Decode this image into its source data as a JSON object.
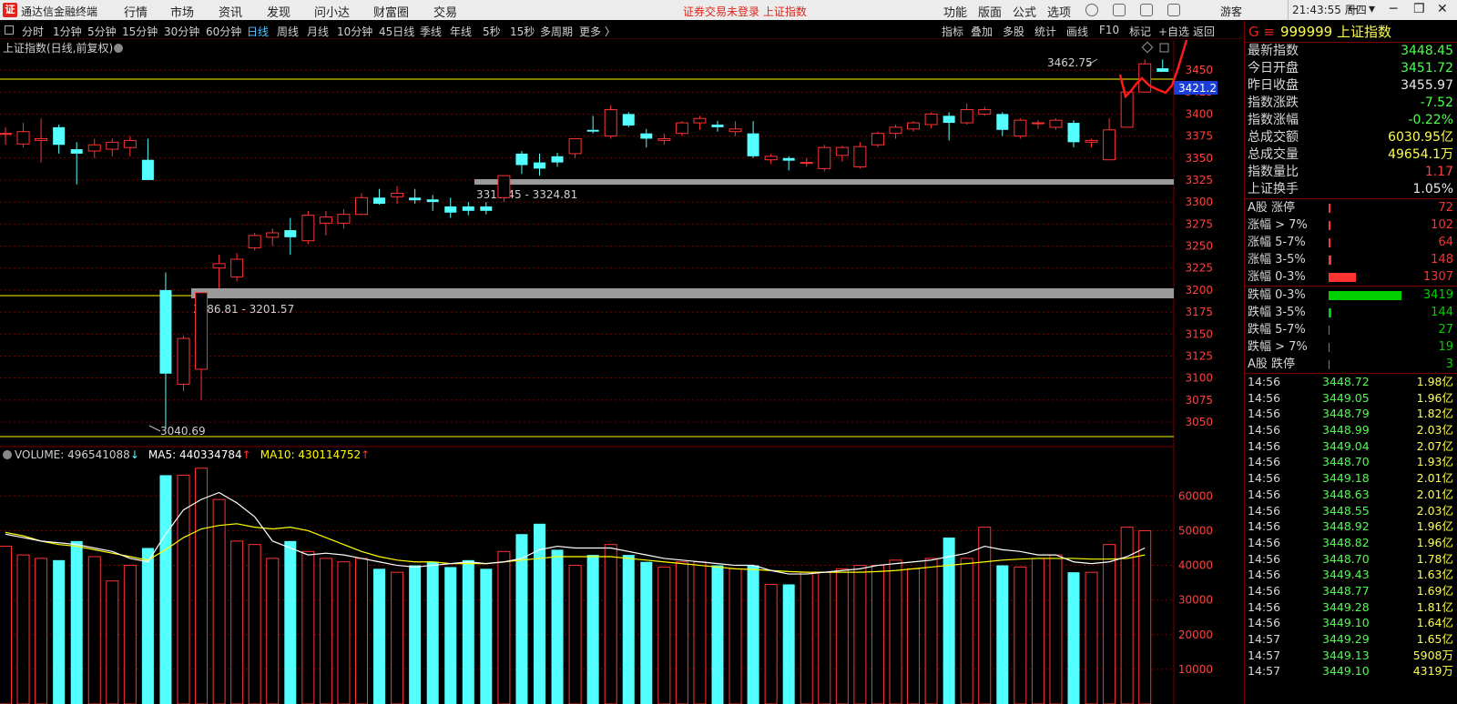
{
  "app": {
    "name": "通达信金融终端",
    "logo": "证",
    "menus": [
      "行情",
      "市场",
      "资讯",
      "发现",
      "问小达",
      "财富圈",
      "交易"
    ],
    "notice": "证券交易未登录  上证指数",
    "right_menus": [
      "功能",
      "版面",
      "公式",
      "选项"
    ],
    "guest": "游客",
    "time": "21:43:55 周四",
    "win_controls": [
      "←",
      "▾",
      "─",
      "❐",
      "✕"
    ]
  },
  "periods": {
    "items": [
      "分时",
      "1分钟",
      "5分钟",
      "15分钟",
      "30分钟",
      "60分钟",
      "日线",
      "周线",
      "月线",
      "10分钟",
      "45日线",
      "季线",
      "年线",
      "5秒",
      "15秒",
      "多周期",
      "更多 〉"
    ],
    "active": "日线",
    "right": [
      "指标",
      "叠加",
      "多股",
      "统计",
      "画线",
      "F10",
      "标记",
      "+自选",
      "返回"
    ]
  },
  "main": {
    "title": "上证指数(日线,前复权)",
    "current_price_tag": "3421.2",
    "high_label": "3462.75",
    "low_label": "3040.69",
    "band1_label": "3316.45 - 3324.81",
    "band2_label": "3186.81 - 3201.57"
  },
  "volume_header": {
    "volume_label": "VOLUME: 496541088",
    "ma5_label": "MA5: 440334784",
    "ma10_label": "MA10: 430114752",
    "down_arrow": "↓",
    "up_arrow": "↑"
  },
  "colors": {
    "up": "#ff3232",
    "down": "#54ffff",
    "grid": "#7a0000",
    "ma5": "#ffffff",
    "ma10": "#ffff00",
    "green": "#00c800"
  },
  "chart_data": {
    "type": "candlestick",
    "y_ticks": [
      "3450",
      "3425",
      "3400",
      "3375",
      "3350",
      "3325",
      "3300",
      "3275",
      "3250",
      "3225",
      "3200",
      "3175",
      "3150",
      "3125",
      "3100",
      "3075",
      "3050"
    ],
    "y_range": [
      3038,
      3472
    ],
    "ohlc": [
      [
        3378,
        3385,
        3365,
        3378
      ],
      [
        3366,
        3390,
        3362,
        3380
      ],
      [
        3370,
        3395,
        3345,
        3372
      ],
      [
        3385,
        3388,
        3355,
        3365
      ],
      [
        3360,
        3368,
        3320,
        3355
      ],
      [
        3358,
        3372,
        3350,
        3365
      ],
      [
        3360,
        3372,
        3352,
        3368
      ],
      [
        3362,
        3375,
        3352,
        3370
      ],
      [
        3348,
        3372,
        3345,
        3325
      ],
      [
        3200,
        3220,
        3042,
        3105
      ],
      [
        3093,
        3148,
        3085,
        3145
      ],
      [
        3110,
        3195,
        3075,
        3197
      ],
      [
        3225,
        3240,
        3202,
        3230
      ],
      [
        3215,
        3242,
        3210,
        3235
      ],
      [
        3248,
        3265,
        3245,
        3262
      ],
      [
        3260,
        3270,
        3250,
        3265
      ],
      [
        3268,
        3282,
        3240,
        3260
      ],
      [
        3256,
        3290,
        3252,
        3285
      ],
      [
        3276,
        3290,
        3262,
        3283
      ],
      [
        3276,
        3292,
        3270,
        3286
      ],
      [
        3286,
        3310,
        3285,
        3305
      ],
      [
        3305,
        3315,
        3297,
        3298
      ],
      [
        3306,
        3318,
        3298,
        3310
      ],
      [
        3305,
        3315,
        3298,
        3302
      ],
      [
        3303,
        3308,
        3290,
        3300
      ],
      [
        3295,
        3305,
        3282,
        3288
      ],
      [
        3295,
        3300,
        3285,
        3290
      ],
      [
        3295,
        3300,
        3286,
        3290
      ],
      [
        3305,
        3325,
        3300,
        3330
      ],
      [
        3355,
        3358,
        3332,
        3342
      ],
      [
        3345,
        3355,
        3330,
        3338
      ],
      [
        3352,
        3356,
        3340,
        3345
      ],
      [
        3355,
        3372,
        3350,
        3372
      ],
      [
        3382,
        3398,
        3378,
        3380
      ],
      [
        3375,
        3410,
        3372,
        3405
      ],
      [
        3400,
        3402,
        3385,
        3387
      ],
      [
        3378,
        3383,
        3362,
        3372
      ],
      [
        3370,
        3378,
        3365,
        3372
      ],
      [
        3378,
        3392,
        3375,
        3390
      ],
      [
        3390,
        3398,
        3382,
        3395
      ],
      [
        3388,
        3392,
        3380,
        3385
      ],
      [
        3380,
        3392,
        3375,
        3383
      ],
      [
        3378,
        3392,
        3350,
        3352
      ],
      [
        3348,
        3355,
        3343,
        3352
      ],
      [
        3350,
        3352,
        3336,
        3347
      ],
      [
        3345,
        3350,
        3340,
        3345
      ],
      [
        3338,
        3365,
        3335,
        3362
      ],
      [
        3353,
        3364,
        3346,
        3362
      ],
      [
        3340,
        3368,
        3338,
        3363
      ],
      [
        3365,
        3380,
        3362,
        3378
      ],
      [
        3378,
        3388,
        3372,
        3385
      ],
      [
        3383,
        3392,
        3380,
        3390
      ],
      [
        3388,
        3402,
        3384,
        3400
      ],
      [
        3398,
        3402,
        3370,
        3390
      ],
      [
        3390,
        3412,
        3388,
        3405
      ],
      [
        3400,
        3408,
        3398,
        3405
      ],
      [
        3400,
        3402,
        3375,
        3382
      ],
      [
        3375,
        3395,
        3372,
        3393
      ],
      [
        3390,
        3393,
        3383,
        3390
      ],
      [
        3385,
        3395,
        3382,
        3393
      ],
      [
        3390,
        3393,
        3362,
        3368
      ],
      [
        3368,
        3372,
        3362,
        3370
      ],
      [
        3348,
        3395,
        3348,
        3382
      ],
      [
        3385,
        3422,
        3385,
        3425
      ],
      [
        3425,
        3462,
        3425,
        3457
      ],
      [
        3452,
        3462,
        3448,
        3448
      ]
    ],
    "volume_ticks": [
      "60000",
      "50000",
      "40000",
      "30000",
      "20000",
      "10000"
    ],
    "volume_range": [
      0,
      69000
    ],
    "volume": [
      45500,
      43000,
      42000,
      41500,
      47000,
      42500,
      35500,
      40000,
      45000,
      66000,
      66000,
      68000,
      59000,
      47000,
      46000,
      42000,
      47000,
      44000,
      42000,
      41000,
      42000,
      39000,
      38000,
      40000,
      41000,
      39500,
      41500,
      39000,
      44000,
      49000,
      52000,
      44500,
      40000,
      43000,
      46000,
      43000,
      41000,
      39500,
      41000,
      41000,
      40000,
      39000,
      40000,
      34500,
      34500,
      38000,
      38000,
      39000,
      40000,
      40000,
      41500,
      39000,
      42000,
      48000,
      42000,
      51000,
      40000,
      39500,
      42000,
      43000,
      38000,
      38000,
      46000,
      51000,
      50000
    ],
    "ma5": [
      49000,
      48000,
      47000,
      46500,
      46000,
      45000,
      44000,
      42000,
      41000,
      49000,
      56000,
      59000,
      61000,
      58000,
      54000,
      47000,
      45000,
      43000,
      43500,
      43000,
      42000,
      41000,
      40000,
      39500,
      40000,
      40500,
      41000,
      40500,
      41000,
      42000,
      44500,
      45500,
      45000,
      45000,
      45000,
      44000,
      43000,
      42000,
      41500,
      41000,
      40500,
      40000,
      40000,
      38500,
      37500,
      37500,
      38000,
      38500,
      39000,
      40000,
      40500,
      41000,
      41500,
      42500,
      43500,
      45500,
      44500,
      44000,
      43000,
      43000,
      41000,
      40500,
      41000,
      42500,
      45000
    ],
    "ma10": [
      49500,
      48500,
      47000,
      46000,
      45500,
      44500,
      43500,
      42500,
      41500,
      44500,
      48000,
      50500,
      51500,
      52000,
      51000,
      50500,
      51000,
      50000,
      48000,
      46000,
      44000,
      42500,
      41500,
      41000,
      41000,
      40500,
      40500,
      40500,
      41000,
      41500,
      42000,
      42500,
      42500,
      42500,
      42500,
      42000,
      41500,
      41000,
      40500,
      40000,
      39500,
      39000,
      38800,
      38500,
      38200,
      38000,
      38000,
      38000,
      38000,
      38200,
      38500,
      39000,
      39500,
      40000,
      40500,
      41000,
      41500,
      41800,
      42000,
      42000,
      42000,
      41800,
      41800,
      42000,
      43000
    ]
  },
  "info": {
    "code": "999999",
    "name": "上证指数",
    "g": "G ≡",
    "quotes": [
      {
        "k": "最新指数",
        "v": "3448.45",
        "c": "#4cff4c"
      },
      {
        "k": "今日开盘",
        "v": "3451.72",
        "c": "#4cff4c"
      },
      {
        "k": "昨日收盘",
        "v": "3455.97",
        "c": "#e8e8e8"
      },
      {
        "k": "指数涨跌",
        "v": "-7.52",
        "c": "#4cff4c"
      },
      {
        "k": "指数涨幅",
        "v": "-0.22%",
        "c": "#4cff4c"
      },
      {
        "k": "总成交额",
        "v": "6030.95亿",
        "c": "#ffff4a"
      },
      {
        "k": "总成交量",
        "v": "49654.1万",
        "c": "#ffff4a"
      },
      {
        "k": "指数量比",
        "v": "1.17",
        "c": "#ff4040"
      },
      {
        "k": "上证换手",
        "v": "1.05%",
        "c": "#e8e8e8"
      }
    ],
    "breadth_up": [
      {
        "k": "A股 涨停",
        "v": "72",
        "frac": 0.02
      },
      {
        "k": "涨幅 > 7%",
        "v": "102",
        "frac": 0.03
      },
      {
        "k": "涨幅 5-7%",
        "v": "64",
        "frac": 0.02
      },
      {
        "k": "涨幅 3-5%",
        "v": "148",
        "frac": 0.04
      },
      {
        "k": "涨幅 0-3%",
        "v": "1307",
        "frac": 0.38
      }
    ],
    "breadth_down": [
      {
        "k": "跌幅 0-3%",
        "v": "3419",
        "frac": 1.0
      },
      {
        "k": "跌幅 3-5%",
        "v": "144",
        "frac": 0.04
      },
      {
        "k": "跌幅 5-7%",
        "v": "27",
        "frac": 0.01
      },
      {
        "k": "跌幅 > 7%",
        "v": "19",
        "frac": 0.01
      },
      {
        "k": "A股 跌停",
        "v": "3",
        "frac": 0.005
      }
    ],
    "ticks": [
      {
        "t": "14:56",
        "p": "3448.72",
        "a": "1.98亿"
      },
      {
        "t": "14:56",
        "p": "3449.05",
        "a": "1.96亿"
      },
      {
        "t": "14:56",
        "p": "3448.79",
        "a": "1.82亿"
      },
      {
        "t": "14:56",
        "p": "3448.99",
        "a": "2.03亿"
      },
      {
        "t": "14:56",
        "p": "3449.04",
        "a": "2.07亿"
      },
      {
        "t": "14:56",
        "p": "3448.70",
        "a": "1.93亿"
      },
      {
        "t": "14:56",
        "p": "3449.18",
        "a": "2.01亿"
      },
      {
        "t": "14:56",
        "p": "3448.63",
        "a": "2.01亿"
      },
      {
        "t": "14:56",
        "p": "3448.55",
        "a": "2.03亿"
      },
      {
        "t": "14:56",
        "p": "3448.92",
        "a": "1.96亿"
      },
      {
        "t": "14:56",
        "p": "3448.82",
        "a": "1.96亿"
      },
      {
        "t": "14:56",
        "p": "3448.70",
        "a": "1.78亿"
      },
      {
        "t": "14:56",
        "p": "3449.43",
        "a": "1.63亿"
      },
      {
        "t": "14:56",
        "p": "3448.77",
        "a": "1.69亿"
      },
      {
        "t": "14:56",
        "p": "3449.28",
        "a": "1.81亿"
      },
      {
        "t": "14:56",
        "p": "3449.10",
        "a": "1.64亿"
      },
      {
        "t": "14:57",
        "p": "3449.29",
        "a": "1.65亿"
      },
      {
        "t": "14:57",
        "p": "3449.13",
        "a": "5908万"
      },
      {
        "t": "14:57",
        "p": "3449.10",
        "a": "4319万"
      }
    ]
  }
}
